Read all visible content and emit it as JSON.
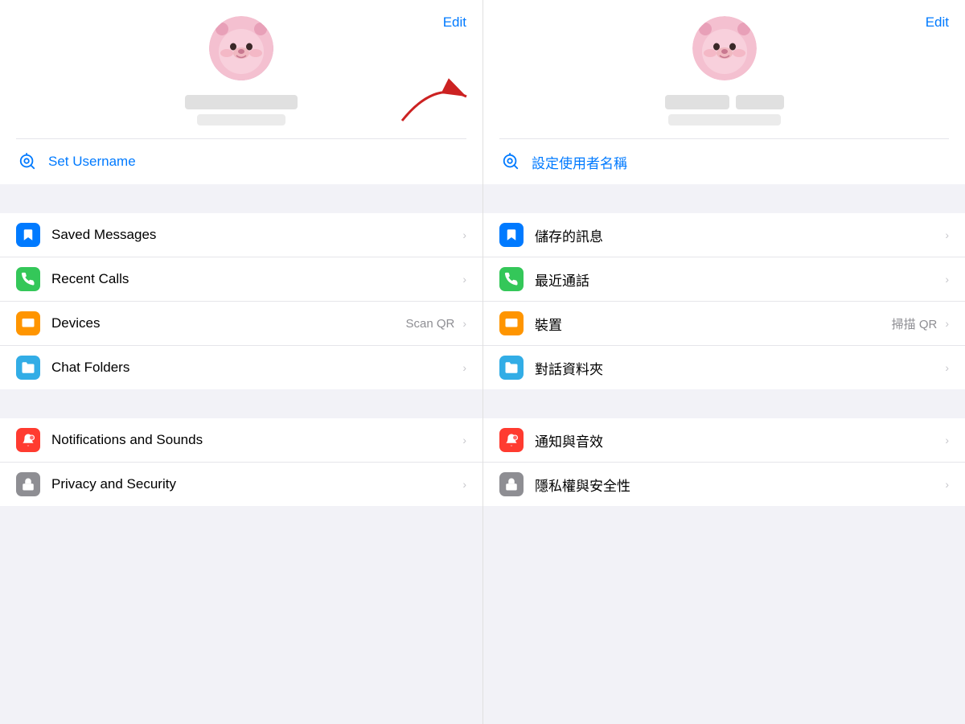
{
  "left_panel": {
    "edit_label": "Edit",
    "profile": {
      "name_blur_width": 140,
      "phone_blur_width": 110
    },
    "username_row": {
      "label": "Set Username",
      "icon": "⊕"
    },
    "settings_groups": [
      {
        "items": [
          {
            "id": "saved-messages",
            "label": "Saved Messages",
            "icon": "🔖",
            "icon_class": "icon-blue",
            "secondary": "",
            "chevron": "›"
          },
          {
            "id": "recent-calls",
            "label": "Recent Calls",
            "icon": "📞",
            "icon_class": "icon-green",
            "secondary": "",
            "chevron": "›"
          },
          {
            "id": "devices",
            "label": "Devices",
            "icon": "💻",
            "icon_class": "icon-orange",
            "secondary": "Scan QR",
            "chevron": "›"
          },
          {
            "id": "chat-folders",
            "label": "Chat Folders",
            "icon": "📁",
            "icon_class": "icon-teal",
            "secondary": "",
            "chevron": "›"
          }
        ]
      },
      {
        "items": [
          {
            "id": "notifications",
            "label": "Notifications and Sounds",
            "icon": "🔔",
            "icon_class": "icon-red",
            "secondary": "",
            "chevron": "›"
          },
          {
            "id": "privacy",
            "label": "Privacy and Security",
            "icon": "🔒",
            "icon_class": "icon-gray",
            "secondary": "",
            "chevron": "›"
          }
        ]
      }
    ]
  },
  "right_panel": {
    "edit_label": "Edit",
    "profile": {
      "name_blur_width": 120,
      "phone_blur_width": 140
    },
    "username_row": {
      "label": "設定使用者名稱",
      "icon": "⊕"
    },
    "settings_groups": [
      {
        "items": [
          {
            "id": "saved-messages-zh",
            "label": "儲存的訊息",
            "icon": "🔖",
            "icon_class": "icon-blue",
            "secondary": "",
            "chevron": "›"
          },
          {
            "id": "recent-calls-zh",
            "label": "最近通話",
            "icon": "📞",
            "icon_class": "icon-green",
            "secondary": "",
            "chevron": "›"
          },
          {
            "id": "devices-zh",
            "label": "裝置",
            "icon": "💻",
            "icon_class": "icon-orange",
            "secondary": "掃描 QR",
            "chevron": "›"
          },
          {
            "id": "chat-folders-zh",
            "label": "對話資料夾",
            "icon": "📁",
            "icon_class": "icon-teal",
            "secondary": "",
            "chevron": "›"
          }
        ]
      },
      {
        "items": [
          {
            "id": "notifications-zh",
            "label": "通知與音效",
            "icon": "🔔",
            "icon_class": "icon-red",
            "secondary": "",
            "chevron": "›"
          },
          {
            "id": "privacy-zh",
            "label": "隱私權與安全性",
            "icon": "🔒",
            "icon_class": "icon-gray",
            "secondary": "",
            "chevron": "›"
          }
        ]
      }
    ]
  },
  "icons": {
    "bookmark": "bookmark",
    "phone": "phone",
    "laptop": "laptop",
    "folder": "folder",
    "bell": "bell",
    "lock": "lock",
    "username": "username"
  },
  "colors": {
    "blue": "#007aff",
    "green": "#34c759",
    "orange": "#ff9500",
    "teal": "#32ade6",
    "red": "#ff3b30",
    "gray": "#8e8e93",
    "divider": "#e5e5ea",
    "background": "#f2f2f7"
  }
}
